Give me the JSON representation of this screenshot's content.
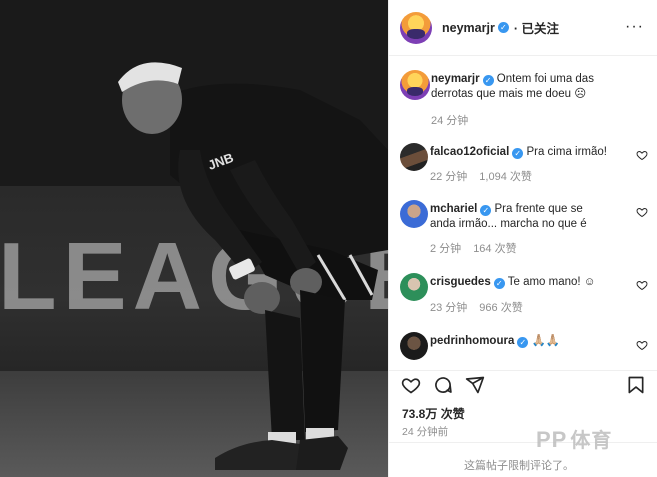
{
  "header": {
    "username": "neymarjr",
    "follow_status": "· 已关注",
    "more_icon": "more-icon"
  },
  "photo": {
    "background_text": "LEAGUE",
    "jersey_text": "JNB"
  },
  "caption": {
    "username": "neymarjr",
    "text": "Ontem foi uma das derrotas que mais me doeu ☹",
    "time": "24 分钟"
  },
  "comments": [
    {
      "username": "falcao12oficial",
      "text": "Pra cima irmão!",
      "time": "22 分钟",
      "likes": "1,094 次赞"
    },
    {
      "username": "mchariel",
      "text": "Pra frente que se anda irmão... marcha no que é",
      "time": "2 分钟",
      "likes": "164 次赞"
    },
    {
      "username": "crisguedes",
      "text": "Te amo mano! ☺",
      "time": "23 分钟",
      "likes": "966 次赞"
    },
    {
      "username": "pedrinhomoura",
      "text": "🙏🏼🙏🏼",
      "time": "",
      "likes": ""
    }
  ],
  "actions": {
    "like_icon": "heart-icon",
    "comment_icon": "comment-icon",
    "share_icon": "share-icon",
    "save_icon": "bookmark-icon"
  },
  "likes_total": "73.8万 次赞",
  "posted_ago": "24 分钟前",
  "comments_limited": "这篇帖子限制评论了。",
  "watermark": {
    "latin": "PP",
    "cjk": "体育"
  },
  "colors": {
    "verified": "#3897f0",
    "muted": "#8e8e8e",
    "text": "#262626",
    "divider": "#efefef"
  }
}
